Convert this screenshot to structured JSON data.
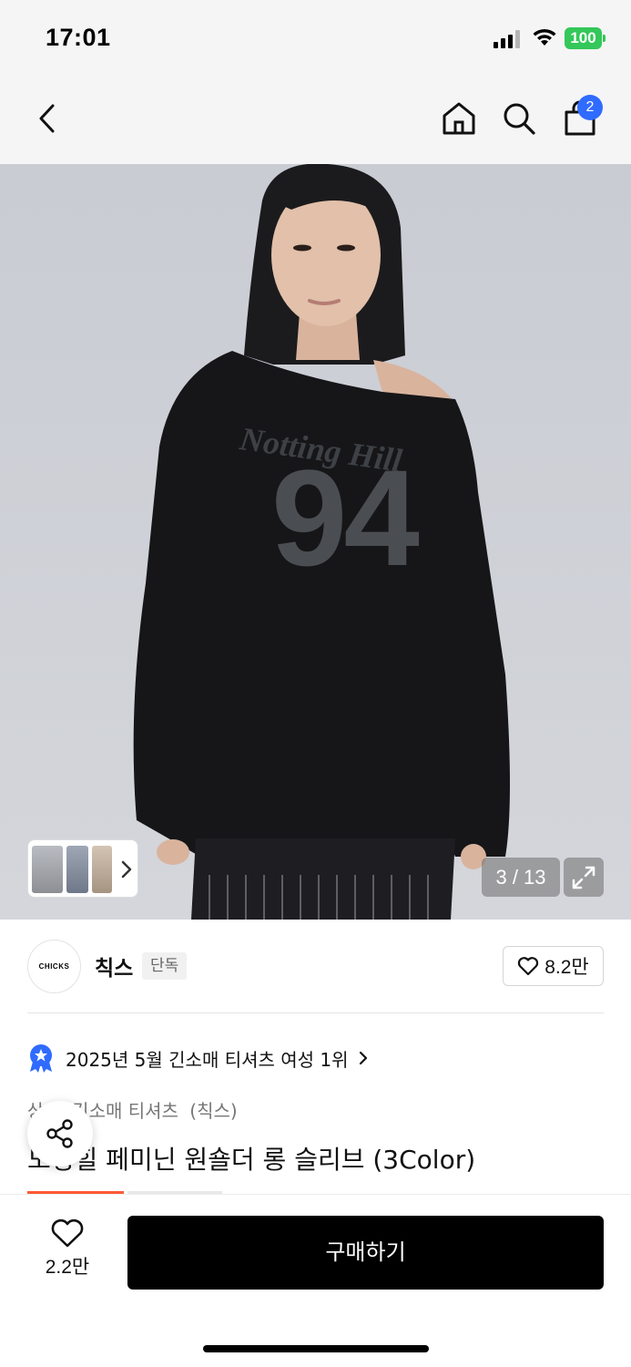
{
  "status_bar": {
    "time": "17:01",
    "battery": "100"
  },
  "nav": {
    "cart_count": "2"
  },
  "gallery": {
    "counter": "3 / 13"
  },
  "brand": {
    "logo_text": "CHICKS",
    "name": "칙스",
    "tag": "단독",
    "like_count": "8.2만"
  },
  "ranking": {
    "text": "2025년 5월 긴소매 티셔츠 여성 1위"
  },
  "category": {
    "path": [
      "상의",
      "긴소매 티셔츠",
      "(칙스)"
    ]
  },
  "product": {
    "title": "노팅힐 페미닌 원숄더 롱 슬리브 (3Color)"
  },
  "bottom_bar": {
    "like_count": "2.2만",
    "buy_label": "구매하기"
  },
  "colors": {
    "badge_blue": "#2f6bff",
    "buy_black": "#000000",
    "battery_green": "#34c759",
    "accent_orange": "#ff5a36"
  }
}
